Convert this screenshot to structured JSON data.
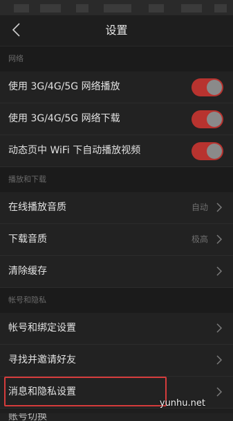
{
  "nav": {
    "title": "设置"
  },
  "sections": {
    "network": "网络",
    "playback": "播放和下载",
    "account": "帐号和隐私"
  },
  "network_rows": [
    {
      "label": "使用 3G/4G/5G 网络播放",
      "on": true
    },
    {
      "label": "使用 3G/4G/5G 网络下载",
      "on": true
    },
    {
      "label": "动态页中 WiFi 下自动播放视频",
      "on": true
    }
  ],
  "playback_rows": [
    {
      "label": "在线播放音质",
      "value": "自动"
    },
    {
      "label": "下载音质",
      "value": "极高"
    },
    {
      "label": "清除缓存",
      "value": ""
    }
  ],
  "account_rows": [
    {
      "label": "帐号和绑定设置"
    },
    {
      "label": "寻找并邀请好友"
    },
    {
      "label": "消息和隐私设置"
    }
  ],
  "partial_row": {
    "label": "账号切换"
  },
  "watermark": "yunhu.net",
  "colors": {
    "accent": "#b8332f",
    "highlight": "#d63c3c",
    "background": "#1e1e1e"
  }
}
